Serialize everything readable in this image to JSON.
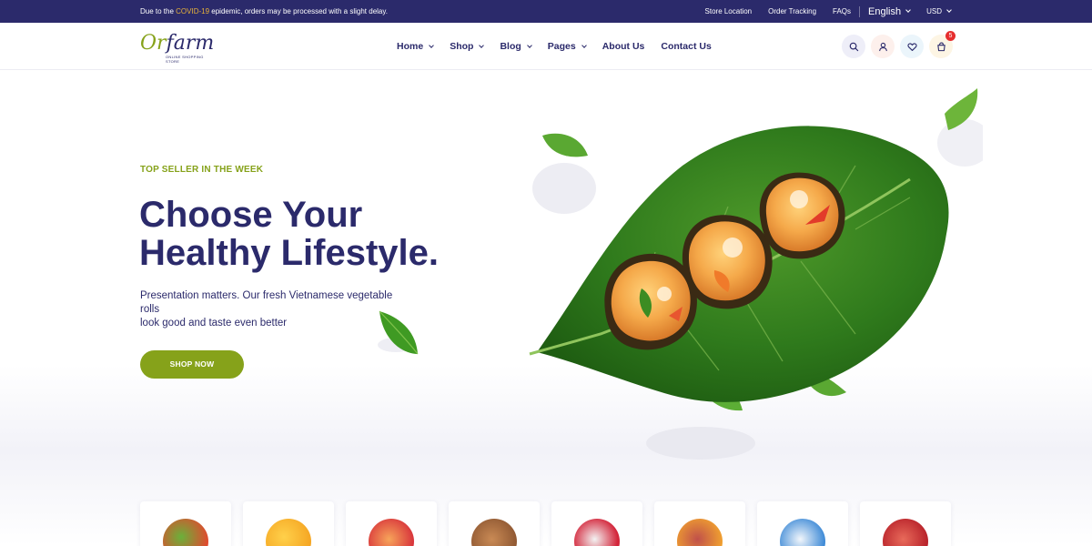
{
  "topbar": {
    "notice_prefix": "Due to the ",
    "notice_highlight": "COVID-19",
    "notice_suffix": " epidemic, orders may be processed with a slight delay.",
    "links": [
      "Store Location",
      "Order Tracking",
      "FAQs"
    ],
    "language": "English",
    "currency": "USD"
  },
  "header": {
    "logo_or": "Or",
    "logo_farm": "farm",
    "logo_tagline": "ONLINE SHOPPING STORE",
    "nav": [
      {
        "label": "Home",
        "dropdown": true
      },
      {
        "label": "Shop",
        "dropdown": true
      },
      {
        "label": "Blog",
        "dropdown": true
      },
      {
        "label": "Pages",
        "dropdown": true
      },
      {
        "label": "About Us",
        "dropdown": false
      },
      {
        "label": "Contact Us",
        "dropdown": false
      }
    ],
    "cart_count": "5",
    "icons": [
      "search-icon",
      "user-icon",
      "heart-icon",
      "cart-icon"
    ]
  },
  "hero": {
    "eyebrow": "TOP SELLER IN THE WEEK",
    "title_line1": "Choose Your",
    "title_line2": "Healthy Lifestyle.",
    "subtitle_line1": "Presentation matters. Our fresh Vietnamese vegetable rolls",
    "subtitle_line2": "look good and taste even better",
    "button": "SHOP NOW"
  },
  "categories": [
    {
      "icon": "vegetables-icon",
      "color": "#e04a2e"
    },
    {
      "icon": "oranges-icon",
      "color": "#f5a623"
    },
    {
      "icon": "juice-icon",
      "color": "#d8343b"
    },
    {
      "icon": "bread-icon",
      "color": "#a2683a"
    },
    {
      "icon": "snacks-icon",
      "color": "#d3253a"
    },
    {
      "icon": "meat-icon",
      "color": "#f0a030"
    },
    {
      "icon": "milk-icon",
      "color": "#3c89d6"
    },
    {
      "icon": "seafood-icon",
      "color": "#d42f2f"
    }
  ],
  "colors": {
    "navy": "#2b2a6b",
    "green": "#86a21a",
    "highlight": "#e8b33a",
    "badge": "#e62e2e"
  }
}
